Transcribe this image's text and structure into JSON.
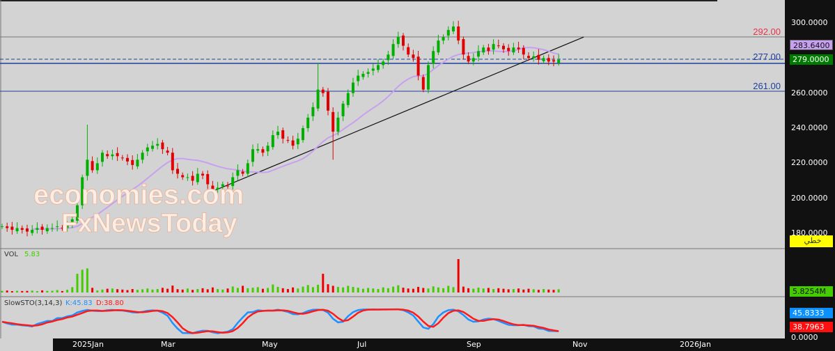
{
  "chart_data": {
    "type": "candlestick",
    "price_axis": {
      "ticks": [
        "300.0000",
        "280.0000",
        "260.0000",
        "240.0000",
        "220.0000",
        "200.0000",
        "180.0000"
      ],
      "tick_values": [
        300,
        280,
        260,
        240,
        220,
        200,
        180
      ],
      "range": [
        178,
        305
      ]
    },
    "time_axis": {
      "labels": [
        "2025Jan",
        "Mar",
        "May",
        "Jul",
        "Sep",
        "Nov",
        "2026Jan"
      ]
    },
    "closes": [
      184,
      183,
      182,
      183,
      182,
      181,
      182,
      183,
      182,
      183,
      183,
      184,
      183,
      185,
      188,
      196,
      212,
      222,
      216,
      220,
      226,
      224,
      225,
      224,
      223,
      221,
      219,
      222,
      226,
      229,
      230,
      231,
      228,
      226,
      216,
      214,
      212,
      212,
      210,
      214,
      213,
      208,
      205,
      206,
      208,
      207,
      212,
      216,
      214,
      220,
      228,
      228,
      226,
      230,
      236,
      238,
      234,
      233,
      230,
      234,
      240,
      246,
      252,
      262,
      260,
      250,
      238,
      246,
      254,
      260,
      266,
      270,
      271,
      272,
      274,
      276,
      278,
      282,
      288,
      292,
      287,
      282,
      280,
      270,
      262,
      276,
      284,
      290,
      292,
      296,
      298,
      290,
      282,
      278,
      280,
      284,
      286,
      284,
      288,
      287,
      285,
      284,
      286,
      285,
      282,
      280,
      281,
      279,
      280,
      278,
      278,
      279
    ],
    "spikes": [
      {
        "index": 17,
        "high": 242
      },
      {
        "index": 63,
        "high": 277
      },
      {
        "index": 66,
        "low": 222
      },
      {
        "index": 79,
        "high": 295
      },
      {
        "index": 90,
        "high": 301
      }
    ],
    "volumes": [
      1.2,
      1.5,
      1.0,
      1.3,
      1.1,
      1.2,
      1.4,
      1.0,
      1.6,
      1.2,
      1.3,
      1.8,
      1.1,
      2.0,
      4.0,
      14,
      17,
      18,
      3.5,
      1.5,
      2.2,
      2.8,
      3.0,
      2.5,
      2.2,
      1.8,
      2.6,
      2.0,
      2.4,
      3.0,
      2.2,
      2.6,
      3.5,
      2.8,
      5.2,
      2.5,
      2.2,
      3.0,
      2.0,
      2.6,
      3.2,
      2.4,
      3.8,
      2.6,
      2.2,
      3.0,
      4.5,
      3.4,
      5.0,
      3.2,
      3.6,
      4.0,
      2.8,
      3.4,
      6.0,
      4.2,
      3.2,
      2.6,
      3.8,
      3.0,
      4.4,
      5.6,
      4.0,
      5.8,
      14,
      6.2,
      5.0,
      4.2,
      3.8,
      5.0,
      4.2,
      3.6,
      2.8,
      3.4,
      3.0,
      2.6,
      3.8,
      3.2,
      4.4,
      5.4,
      3.6,
      3.0,
      2.8,
      4.2,
      3.4,
      3.0,
      4.6,
      3.8,
      3.2,
      5.0,
      4.0,
      25,
      4.4,
      3.2,
      2.8,
      3.6,
      3.0,
      3.4,
      2.6,
      3.2,
      2.8,
      2.4,
      2.6,
      3.0,
      2.2,
      2.8,
      2.4,
      2.0,
      2.6,
      2.2,
      2.0,
      2.4
    ],
    "volume_max": 25,
    "ma_period": 20,
    "horizontal_lines": [
      {
        "value": 292,
        "label": "292.00",
        "color": "#e8334a"
      },
      {
        "value": 277,
        "label": "277.00",
        "color": "#1f3f9c",
        "style": "dashed"
      },
      {
        "value": 261,
        "label": "261.00",
        "color": "#1f3f9c"
      }
    ],
    "trendline": {
      "from": {
        "index": 42,
        "price": 204
      },
      "to": {
        "index": 116,
        "price": 292
      }
    },
    "markers": {
      "ma_value": "283.6400",
      "last_price": "279.0000",
      "volume_value": "5.8254M",
      "k_value": "45.8333",
      "d_value": "38.7963",
      "sto_zero": "0.0000"
    },
    "style_label": "خطي"
  },
  "volume_panel": {
    "title": "VOL",
    "value": "5.83"
  },
  "sto_panel": {
    "title": "SlowSTO(3,14,3)",
    "k": "K:45.83",
    "d": "D:38.80"
  },
  "watermark": {
    "line1": "economies.com",
    "line2": "FxNewsToday"
  },
  "colors": {
    "up": "#00b000",
    "down": "#e00000",
    "ma": "#c8a0f0",
    "k": "#1e90ff",
    "d": "#ff1a1a"
  }
}
